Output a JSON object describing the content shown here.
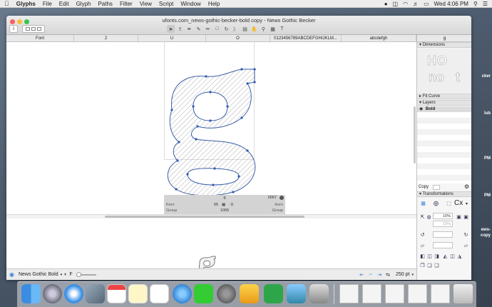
{
  "menubar": {
    "app_name": "Glyphs",
    "items": [
      "File",
      "Edit",
      "Glyph",
      "Paths",
      "Filter",
      "View",
      "Script",
      "Window",
      "Help"
    ],
    "clock": "Wed 4:06 PM",
    "battery_symbol": "▭",
    "wifi_symbol": "◠"
  },
  "window": {
    "title": "ufonts.com_news-gothic-becker-bold copy - News Gothic Becker",
    "info_button": "i"
  },
  "tabs": [
    {
      "label": "Font"
    },
    {
      "label": "2"
    },
    {
      "label": "U"
    },
    {
      "label": "O"
    },
    {
      "label": "0123456789ABCDEFGHIJKLM..."
    },
    {
      "label": "abcdefgh"
    },
    {
      "label": "g"
    }
  ],
  "infobox": {
    "glyph_name": "g",
    "unicode": "0067",
    "kern_left_label": "Kern",
    "kern_right_label": "Kern",
    "group_left_label": "Group",
    "group_right_label": "Group",
    "lsb": "65",
    "rsb": "-9",
    "width": "1065"
  },
  "panel": {
    "dimensions_label": "Dimensions",
    "dim_top": "HO",
    "dim_bottom_left": "no",
    "dim_bottom_right": "t",
    "fit_curve_label": "Fit Curve",
    "layers_label": "Layers",
    "layer_active": "Bold",
    "copy_button": "Copy",
    "transformations_label": "Transformations",
    "scale_x": "10%",
    "scale_y": "10%",
    "cx_label": "Cx"
  },
  "statusbar": {
    "font_name": "News Gothic Bold",
    "size": "250 pt",
    "f_label": "F"
  },
  "colors": {
    "accent": "#3b7fd9",
    "glyph_outline": "#3a5fa8",
    "node": "#2a58b0",
    "close": "#fc605c",
    "minimize": "#fdbc40",
    "zoom": "#34c84a"
  },
  "desktop_labels": [
    "cker",
    "lub",
    "PM",
    "PM",
    "ews-",
    "copy"
  ]
}
